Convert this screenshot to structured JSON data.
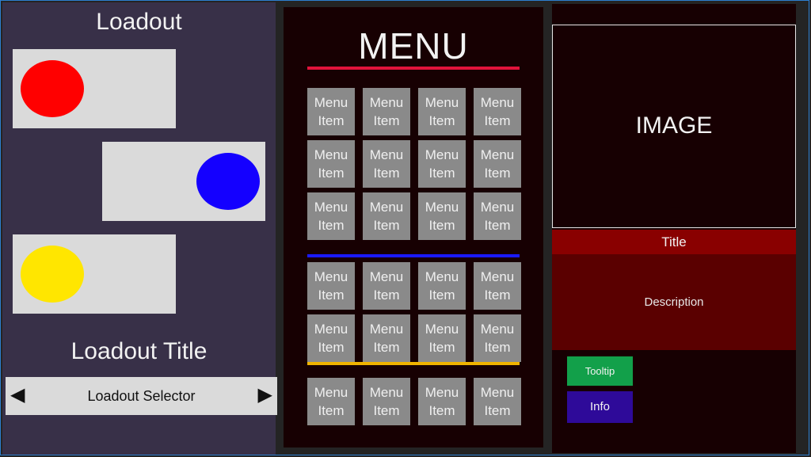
{
  "colors": {
    "panel_left": "#383048",
    "panel_dark": "#170002",
    "slot_bg": "#dadada",
    "menu_item_bg": "#8a8a8a",
    "rule_red": "#e0133b",
    "rule_blue": "#1a1aff",
    "rule_yellow": "#f0b400",
    "title_bar": "#890000",
    "description_bg": "#5a0000",
    "tooltip_btn": "#12a04a",
    "info_btn": "#2e0a99"
  },
  "loadout": {
    "heading": "Loadout",
    "slots": [
      {
        "color": "#ff0000"
      },
      {
        "color": "#1400ff"
      },
      {
        "color": "#ffe600"
      }
    ],
    "title": "Loadout Title",
    "selector": {
      "label": "Loadout Selector",
      "left_arrow": "◀",
      "right_arrow": "▶"
    }
  },
  "menu": {
    "heading": "MENU",
    "sections": [
      {
        "rule_color": "#e0133b",
        "rows": 3
      },
      {
        "rule_color": "#1a1aff",
        "rows": 2
      },
      {
        "rule_color": "#f0b400",
        "rows": 1
      }
    ],
    "item_label": "Menu Item"
  },
  "detail": {
    "image_label": "IMAGE",
    "title": "Title",
    "description": "Description",
    "tooltip_label": "Tooltip",
    "info_label": "Info"
  }
}
